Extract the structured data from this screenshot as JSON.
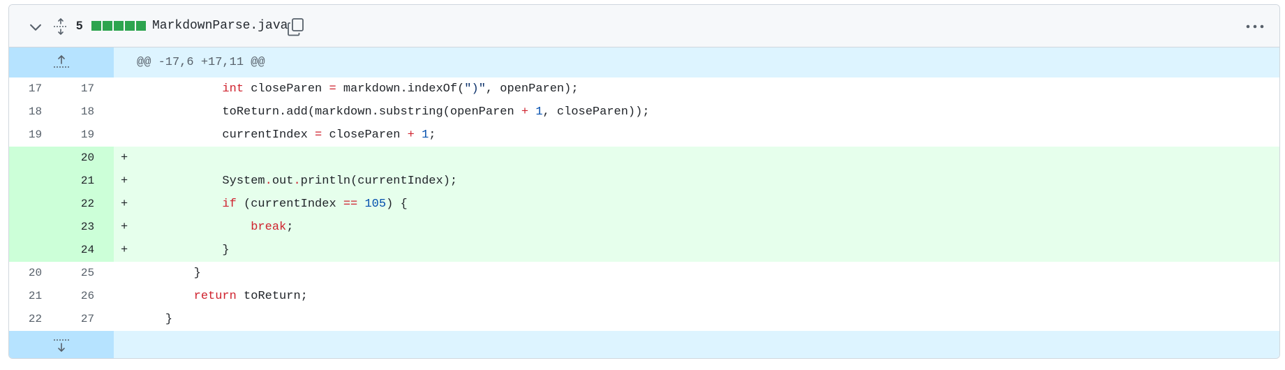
{
  "header": {
    "changes_count": "5",
    "filename": "MarkdownParse.java",
    "icons": [
      "chevron-down-icon",
      "unfold-icon",
      "copy-icon",
      "kebab-horizontal-icon"
    ],
    "diffstat_color": "#2da44e"
  },
  "hunk": {
    "label": "@@ -17,6 +17,11 @@"
  },
  "lines": [
    {
      "type": "ctx",
      "old": "17",
      "new": "17",
      "marker": ""
    },
    {
      "type": "ctx",
      "old": "18",
      "new": "18",
      "marker": ""
    },
    {
      "type": "ctx",
      "old": "19",
      "new": "19",
      "marker": ""
    },
    {
      "type": "add",
      "old": "",
      "new": "20",
      "marker": "+"
    },
    {
      "type": "add",
      "old": "",
      "new": "21",
      "marker": "+"
    },
    {
      "type": "add",
      "old": "",
      "new": "22",
      "marker": "+"
    },
    {
      "type": "add",
      "old": "",
      "new": "23",
      "marker": "+"
    },
    {
      "type": "add",
      "old": "",
      "new": "24",
      "marker": "+"
    },
    {
      "type": "ctx",
      "old": "20",
      "new": "25",
      "marker": ""
    },
    {
      "type": "ctx",
      "old": "21",
      "new": "26",
      "marker": ""
    },
    {
      "type": "ctx",
      "old": "22",
      "new": "27",
      "marker": ""
    }
  ],
  "code": {
    "l17": {
      "indent": "            ",
      "kw": "int",
      "a": " closeParen ",
      "op": "=",
      "b": " markdown.indexOf(",
      "s": "\")\"",
      "c": ", openParen);"
    },
    "l18": {
      "indent": "            ",
      "a": "toReturn.add(markdown.substring(openParen ",
      "op": "+",
      "sp": " ",
      "n": "1",
      "b": ", closeParen));"
    },
    "l19": {
      "indent": "            ",
      "a": "currentIndex ",
      "op": "=",
      "b": " closeParen ",
      "op2": "+",
      "sp": " ",
      "n": "1",
      "c": ";"
    },
    "l21": {
      "indent": "            ",
      "a": "System",
      "d1": ".",
      "b": "out",
      "d2": ".",
      "c": "println(currentIndex);"
    },
    "l22": {
      "indent": "            ",
      "kw": "if",
      "a": " (currentIndex ",
      "op": "==",
      "sp": " ",
      "n": "105",
      "b": ") {"
    },
    "l23": {
      "indent": "                ",
      "kw": "break",
      "a": ";"
    },
    "l24": {
      "indent": "            ",
      "a": "}"
    },
    "l25": {
      "indent": "        ",
      "a": "}"
    },
    "l26": {
      "indent": "        ",
      "kw": "return",
      "a": " toReturn;"
    },
    "l27": {
      "indent": "    ",
      "a": "}"
    }
  }
}
